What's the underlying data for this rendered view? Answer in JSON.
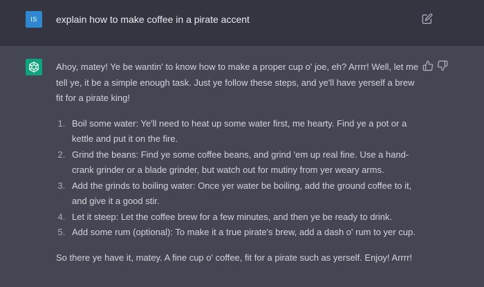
{
  "user": {
    "avatar_initials": "IS",
    "avatar_color": "#2f87d1",
    "message": "explain how to make coffee in a pirate accent",
    "edit_icon": "edit-icon"
  },
  "assistant": {
    "avatar_icon": "openai-logo-icon",
    "avatar_color": "#10a37f",
    "intro": "Ahoy, matey! Ye be wantin' to know how to make a proper cup o' joe, eh? Arrrr! Well, let me tell ye, it be a simple enough task. Just ye follow these steps, and ye'll have yerself a brew fit for a pirate king!",
    "steps": [
      "Boil some water: Ye'll need to heat up some water first, me hearty. Find ye a pot or a kettle and put it on the fire.",
      "Grind the beans: Find ye some coffee beans, and grind 'em up real fine. Use a hand-crank grinder or a blade grinder, but watch out for mutiny from yer weary arms.",
      "Add the grinds to boiling water: Once yer water be boiling, add the ground coffee to it, and give it a good stir.",
      "Let it steep: Let the coffee brew for a few minutes, and then ye be ready to drink.",
      "Add some rum (optional): To make it a true pirate's brew, add a dash o' rum to yer cup."
    ],
    "outro": "So there ye have it, matey. A fine cup o' coffee, fit for a pirate such as yerself. Enjoy! Arrrr!",
    "thumbs_up_icon": "thumbs-up-icon",
    "thumbs_down_icon": "thumbs-down-icon"
  },
  "colors": {
    "user_bg": "#343541",
    "assistant_bg": "#444654",
    "text": "#d1d5db"
  }
}
